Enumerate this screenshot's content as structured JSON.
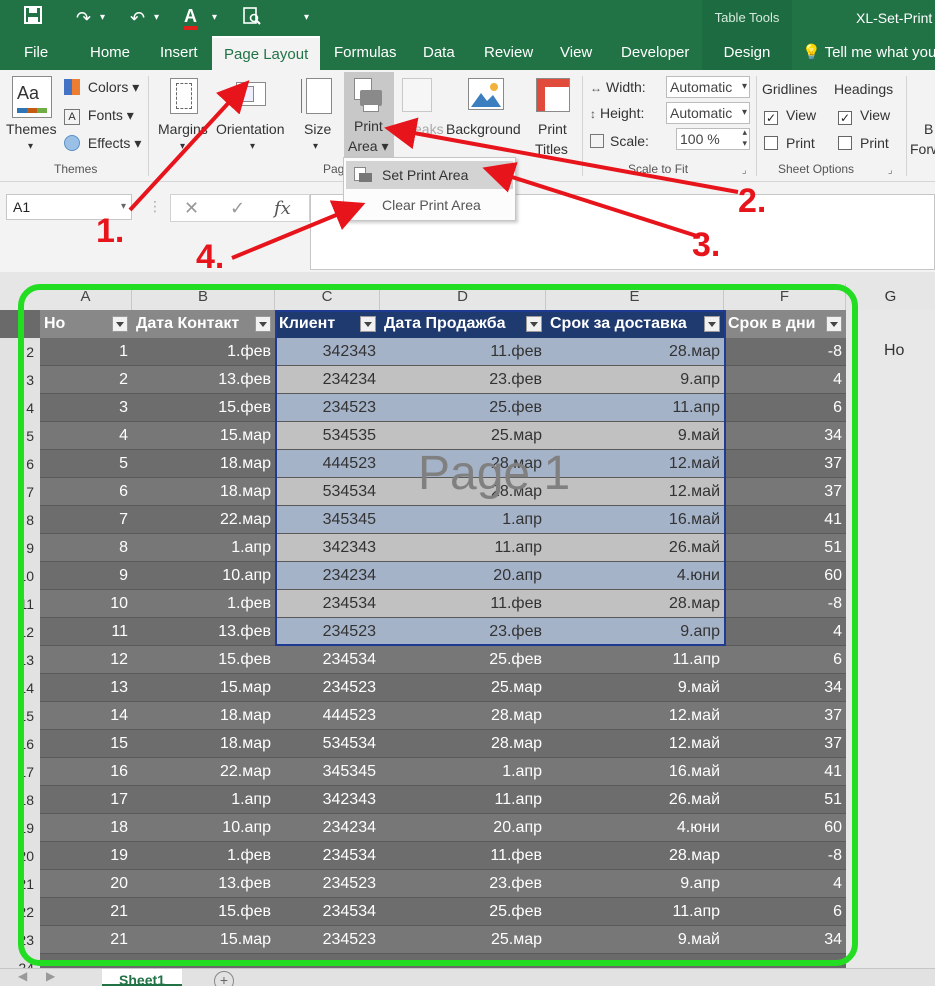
{
  "title_bar": {
    "table_tools": "Table Tools",
    "doc_title": "XL-Set-Print",
    "font_color_letter": "A"
  },
  "tabs": [
    "File",
    "Home",
    "Insert",
    "Page Layout",
    "Formulas",
    "Data",
    "Review",
    "View",
    "Developer",
    "Design",
    "Tell me what you"
  ],
  "ribbon": {
    "themes": "Themes",
    "colors": "Colors",
    "fonts": "Fonts",
    "effects": "Effects",
    "themes_group": "Themes",
    "margins": "Margins",
    "orientation": "Orientation",
    "size": "Size",
    "print_area_1": "Print",
    "print_area_2": "Area",
    "breaks": "Breaks",
    "background": "Background",
    "print_titles_1": "Print",
    "print_titles_2": "Titles",
    "page_group": "Pag",
    "width_label": "Width:",
    "width_value": "Automatic",
    "height_label": "Height:",
    "height_value": "Automatic",
    "scale_label": "Scale:",
    "scale_value": "100 %",
    "scale_group": "Scale to Fit",
    "gridlines": "Gridlines",
    "headings": "Headings",
    "view": "View",
    "print": "Print",
    "sheet_options_group": "Sheet Options",
    "bring_1": "B",
    "bring_2": "Forw"
  },
  "dropdown": {
    "set": "Set Print Area",
    "clear": "Clear Print Area"
  },
  "formula_bar": {
    "namebox": "A1",
    "fx": "fx"
  },
  "sheet": {
    "columns": [
      "A",
      "B",
      "C",
      "D",
      "E",
      "F",
      "G"
    ],
    "headers": [
      "Но",
      "Дата Контакт",
      "Клиент",
      "Дата Продажба",
      "Срок за доставка",
      "Срок в дни"
    ],
    "watermark": "Page 1",
    "g2": "Но",
    "row_numbers": [
      "2",
      "3",
      "4",
      "5",
      "6",
      "7",
      "8",
      "9",
      "10",
      "11",
      "12",
      "13",
      "14",
      "15",
      "16",
      "17",
      "18",
      "19",
      "20",
      "21",
      "22",
      "23",
      "24"
    ],
    "rows": [
      [
        "1",
        "1.фев",
        "342343",
        "11.фев",
        "28.мар",
        "-8"
      ],
      [
        "2",
        "13.фев",
        "234234",
        "23.фев",
        "9.апр",
        "4"
      ],
      [
        "3",
        "15.фев",
        "234523",
        "25.фев",
        "11.апр",
        "6"
      ],
      [
        "4",
        "15.мар",
        "534535",
        "25.мар",
        "9.май",
        "34"
      ],
      [
        "5",
        "18.мар",
        "444523",
        "28.мар",
        "12.май",
        "37"
      ],
      [
        "6",
        "18.мар",
        "534534",
        "28.мар",
        "12.май",
        "37"
      ],
      [
        "7",
        "22.мар",
        "345345",
        "1.апр",
        "16.май",
        "41"
      ],
      [
        "8",
        "1.апр",
        "342343",
        "11.апр",
        "26.май",
        "51"
      ],
      [
        "9",
        "10.апр",
        "234234",
        "20.апр",
        "4.юни",
        "60"
      ],
      [
        "10",
        "1.фев",
        "234534",
        "11.фев",
        "28.мар",
        "-8"
      ],
      [
        "11",
        "13.фев",
        "234523",
        "23.фев",
        "9.апр",
        "4"
      ],
      [
        "12",
        "15.фев",
        "234534",
        "25.фев",
        "11.апр",
        "6"
      ],
      [
        "13",
        "15.мар",
        "234523",
        "25.мар",
        "9.май",
        "34"
      ],
      [
        "14",
        "18.мар",
        "444523",
        "28.мар",
        "12.май",
        "37"
      ],
      [
        "15",
        "18.мар",
        "534534",
        "28.мар",
        "12.май",
        "37"
      ],
      [
        "16",
        "22.мар",
        "345345",
        "1.апр",
        "16.май",
        "41"
      ],
      [
        "17",
        "1.апр",
        "342343",
        "11.апр",
        "26.май",
        "51"
      ],
      [
        "18",
        "10.апр",
        "234234",
        "20.апр",
        "4.юни",
        "60"
      ],
      [
        "19",
        "1.фев",
        "234534",
        "11.фев",
        "28.мар",
        "-8"
      ],
      [
        "20",
        "13.фев",
        "234523",
        "23.фев",
        "9.апр",
        "4"
      ],
      [
        "21",
        "15.фев",
        "234534",
        "25.фев",
        "11.апр",
        "6"
      ],
      [
        "21",
        "15.мар",
        "234523",
        "25.мар",
        "9.май",
        "34"
      ]
    ]
  },
  "sheet_tabs": {
    "active": "Sheet1",
    "add": "+"
  },
  "annotations": {
    "a1": "1.",
    "a2": "2.",
    "a3": "3.",
    "a4": "4."
  },
  "colors": {
    "excel_green": "#217346",
    "arrow_red": "#e8141b",
    "highlight_green": "#22dd22",
    "print_area_border": "#1f3a93"
  }
}
